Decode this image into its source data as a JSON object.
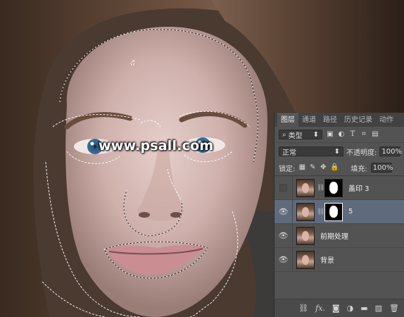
{
  "watermark": {
    "text": "www.psall.com"
  },
  "layers_panel": {
    "tabs": [
      {
        "label": "图层",
        "active": true
      },
      {
        "label": "通道",
        "active": false
      },
      {
        "label": "路径",
        "active": false
      },
      {
        "label": "历史记录",
        "active": false
      },
      {
        "label": "动作",
        "active": false
      }
    ],
    "filter": {
      "label": "类型",
      "icons": [
        "image-filter-icon",
        "adjustment-filter-icon",
        "type-filter-icon",
        "shape-filter-icon",
        "smart-object-filter-icon"
      ]
    },
    "blend_mode": "正常",
    "opacity_label": "不透明度:",
    "opacity_value": "100%",
    "lock_label": "锁定:",
    "fill_label": "填充:",
    "fill_value": "100%",
    "layers": [
      {
        "name": "盖印 3",
        "visible": false,
        "has_mask": true,
        "selected": false
      },
      {
        "name": "5",
        "visible": true,
        "has_mask": true,
        "selected": true
      },
      {
        "name": "前期处理",
        "visible": true,
        "has_mask": false,
        "selected": false
      },
      {
        "name": "背景",
        "visible": true,
        "has_mask": false,
        "selected": false
      }
    ],
    "bottom_icons": [
      "link-icon",
      "fx-icon",
      "add-mask-icon",
      "adjustment-icon",
      "group-icon",
      "new-layer-icon",
      "delete-icon"
    ],
    "bottom_labels": {
      "fx": "fx."
    }
  },
  "colors": {
    "panel_bg": "#535353",
    "selected_layer": "#5f6b7d",
    "panel_header": "#424242"
  }
}
